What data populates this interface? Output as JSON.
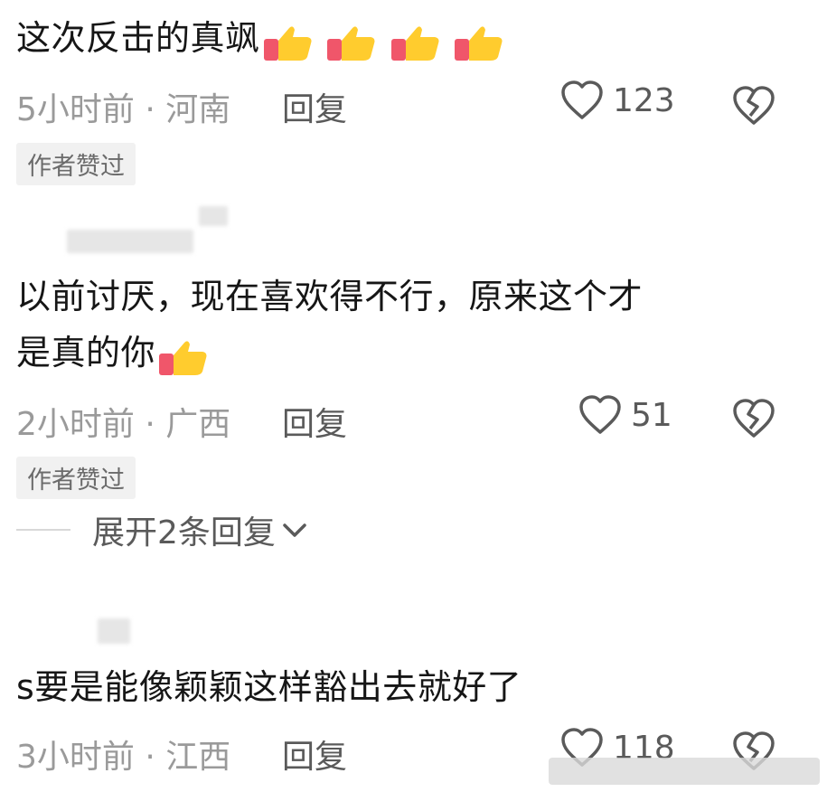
{
  "comments": [
    {
      "text": "这次反击的真飒",
      "time": "5小时前",
      "sep": "·",
      "location": "河南",
      "reply": "回复",
      "likes": "123",
      "badge": "作者赞过",
      "thumbs": 4
    },
    {
      "text_line1": "以前讨厌，现在喜欢得不行，原来这个才",
      "text_line2": "是真的你",
      "time": "2小时前",
      "sep": "·",
      "location": "广西",
      "reply": "回复",
      "likes": "51",
      "badge": "作者赞过",
      "thumbs": 1
    },
    {
      "text": "s要是能像颖颖这样豁出去就好了",
      "time": "3小时前",
      "sep": "·",
      "location": "江西",
      "reply": "回复",
      "likes": "118"
    }
  ],
  "expand_label": "展开2条回复",
  "icons": {
    "like": "heart-icon",
    "dislike": "broken-heart-icon",
    "thumb": "thumbs-up-emoji",
    "expand": "chevron-down-icon"
  },
  "colors": {
    "thumb_yellow": "#ffcc2e",
    "thumb_cuff": "#f0566a",
    "meta_gray": "#9a9a9a",
    "icon_gray": "#5a5a5a",
    "badge_bg": "#f1f1f1"
  }
}
